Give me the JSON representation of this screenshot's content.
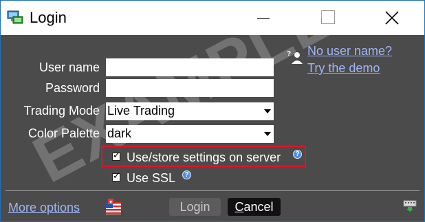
{
  "window": {
    "title": "Login"
  },
  "form": {
    "username_label": "User name",
    "username_value": "",
    "password_label": "Password",
    "password_value": "",
    "trading_mode_label": "Trading Mode",
    "trading_mode_value": "Live Trading",
    "color_palette_label": "Color Palette",
    "color_palette_value": "dark"
  },
  "links": {
    "no_username": "No user name?",
    "try_demo": "Try the demo",
    "more_options": "More options"
  },
  "options": {
    "store_settings_label": "Use/store settings on server",
    "store_settings_checked": true,
    "use_ssl_label": "Use SSL",
    "use_ssl_checked": true
  },
  "buttons": {
    "login_label": "Login",
    "cancel_label_first": "C",
    "cancel_label_rest": "ancel"
  },
  "watermark": "EXAMPLE",
  "colors": {
    "background": "#4b4b4b",
    "link": "#9fb6f5",
    "highlight_border": "#e0142a"
  }
}
